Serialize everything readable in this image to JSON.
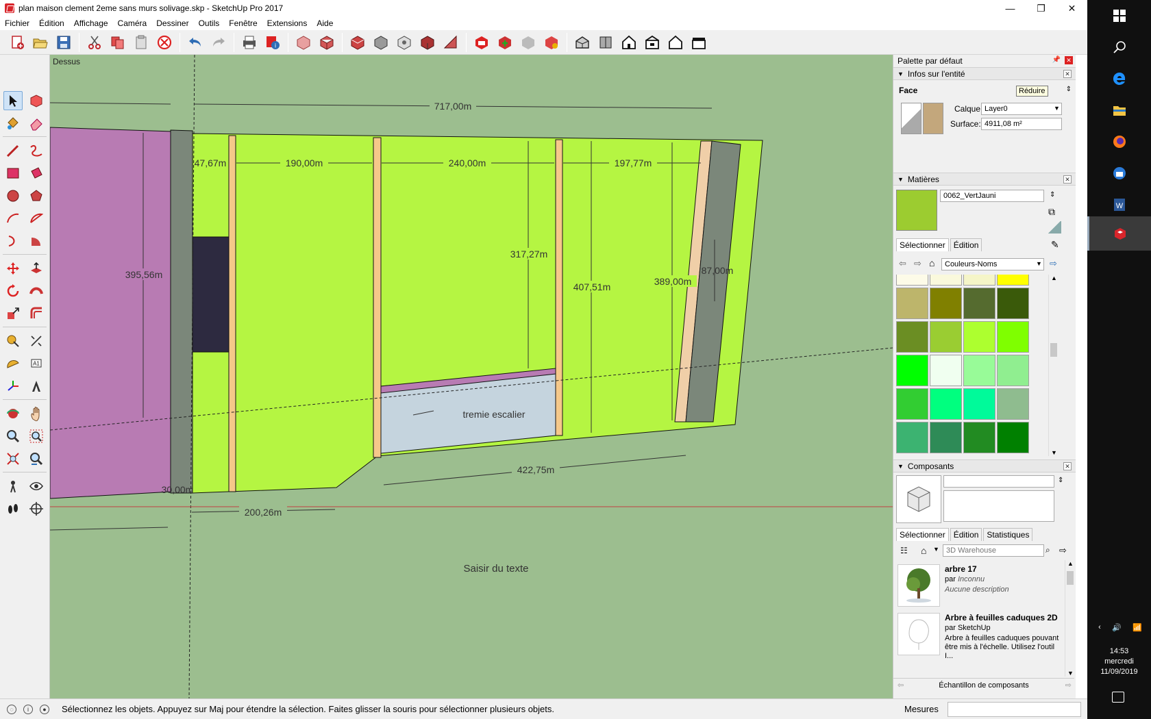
{
  "window": {
    "title": "plan maison clement 2eme sans murs solivage.skp - SketchUp Pro 2017",
    "controls": {
      "minimize": "—",
      "maximize": "❐",
      "close": "✕"
    }
  },
  "menu": [
    "Fichier",
    "Édition",
    "Affichage",
    "Caméra",
    "Dessiner",
    "Outils",
    "Fenêtre",
    "Extensions",
    "Aide"
  ],
  "toolbar": {
    "groups": [
      [
        "new-icon",
        "open-icon",
        "save-icon"
      ],
      [
        "cut-icon",
        "copy-icon",
        "paste-icon",
        "erase-icon"
      ],
      [
        "undo-icon",
        "redo-icon"
      ],
      [
        "print-icon",
        "model-info-icon"
      ],
      [
        "xray-icon",
        "wireframe-icon",
        "hidden-line-icon",
        "shaded-icon",
        "textured-icon",
        "monochrome-icon"
      ],
      [
        "3d-warehouse-icon",
        "share-model-icon",
        "extension-warehouse-icon",
        "components-icon"
      ],
      [
        "iso-view-icon",
        "top-view-icon",
        "front-view-icon",
        "right-view-icon",
        "back-view-icon",
        "left-view-icon"
      ]
    ]
  },
  "viewport": {
    "view_label": "Dessus",
    "dimensions": {
      "d717": "717,00m",
      "d47": "47,67m",
      "d190": "190,00m",
      "d240": "240,00m",
      "d197": "197,77m",
      "d395": "395,56m",
      "d317": "317,27m",
      "d407": "407,51m",
      "d389": "389,00m",
      "d87": "87,00m",
      "d422": "422,75m",
      "d200": "200,26m",
      "d30": "30,00m"
    },
    "labels": {
      "tremie": "tremie escalier",
      "saisir": "Saisir du texte"
    }
  },
  "tray": {
    "title": "Palette par défaut",
    "entity_info": {
      "header": "Infos sur l'entité",
      "type": "Face",
      "layer_label": "Calque:",
      "layer_value": "Layer0",
      "area_label": "Surface:",
      "area_value": "4911,08 m²",
      "tooltip": "Réduire"
    },
    "materials": {
      "header": "Matières",
      "name": "0062_VertJauni",
      "current_color": "#9ccc30",
      "tab_select": "Sélectionner",
      "tab_edit": "Édition",
      "library": "Couleurs-Noms",
      "swatches": [
        "#fdfbe8",
        "#faf9dc",
        "#f5f5c8",
        "#ffff00",
        "#bdb56b",
        "#808000",
        "#556b2f",
        "#3a5a0a",
        "#6b8e23",
        "#9acd32",
        "#adff2f",
        "#7fff00",
        "#00ff00",
        "#f0fff0",
        "#98fb98",
        "#90ee90",
        "#32cd32",
        "#00ff7f",
        "#00fa9a",
        "#8fbc8f",
        "#3cb371",
        "#2e8b57",
        "#228b22",
        "#008000"
      ]
    },
    "components": {
      "header": "Composants",
      "tab_select": "Sélectionner",
      "tab_edit": "Édition",
      "tab_stats": "Statistiques",
      "search_placeholder": "3D Warehouse",
      "items": [
        {
          "title": "arbre 17",
          "by_prefix": "par",
          "author": "Inconnu",
          "desc": "Aucune description"
        },
        {
          "title": "Arbre à feuilles caduques 2D",
          "by_prefix": "par",
          "author": "SketchUp",
          "desc": "Arbre à feuilles caduques pouvant être mis à l'échelle. Utilisez l'outil I..."
        }
      ],
      "footer": "Échantillon de composants"
    }
  },
  "statusbar": {
    "message": "Sélectionnez les objets. Appuyez sur Maj pour étendre la sélection. Faites glisser la souris pour sélectionner plusieurs objets.",
    "measures_label": "Mesures"
  },
  "taskbar": {
    "time": "14:53",
    "day": "mercredi",
    "date": "11/09/2019"
  }
}
